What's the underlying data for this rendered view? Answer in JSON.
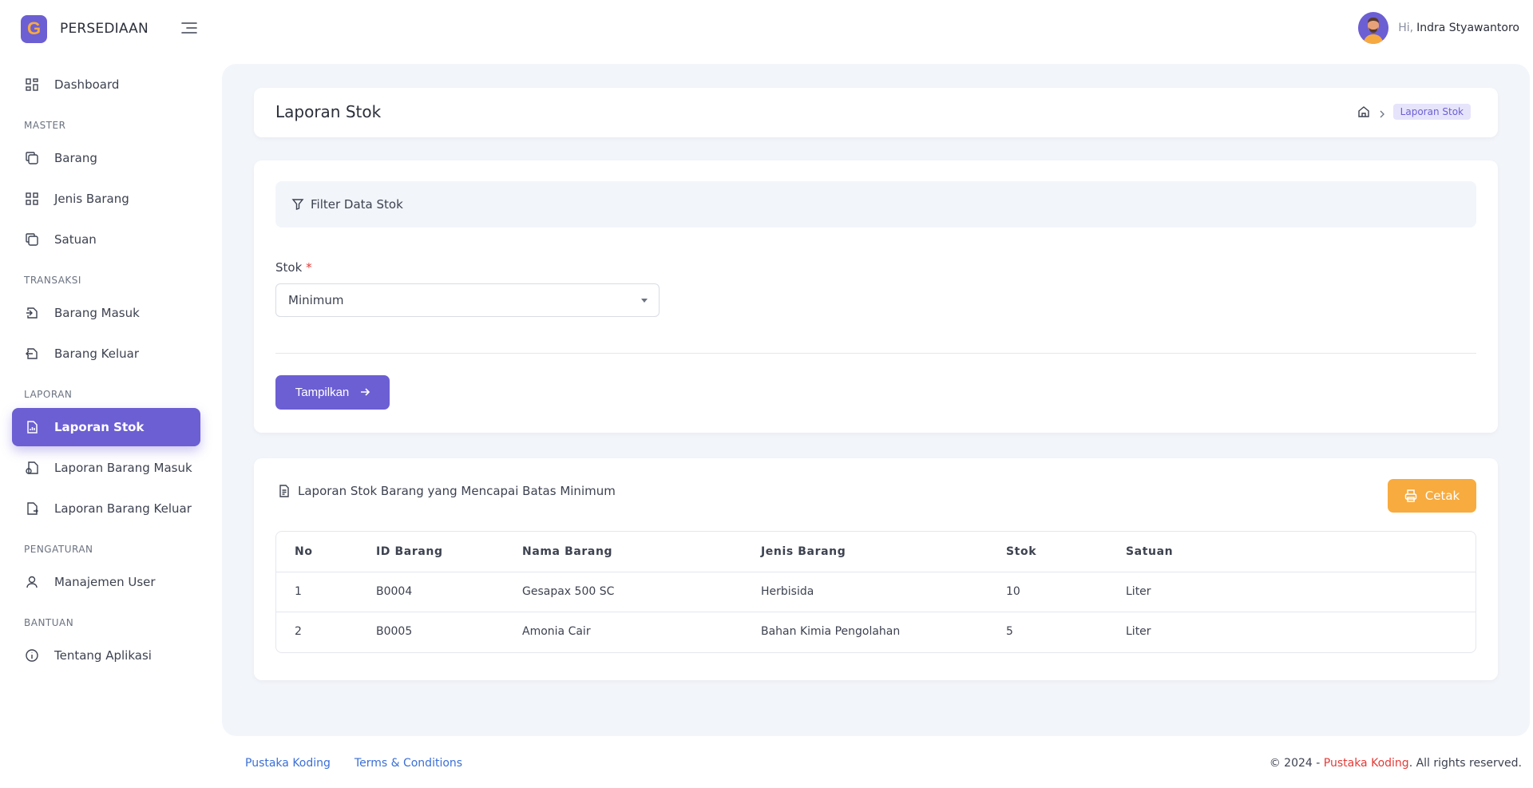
{
  "brand": {
    "logo_letter": "G",
    "name": "PERSEDIAAN"
  },
  "user": {
    "greeting": "Hi,",
    "name": "Indra Styawantoro"
  },
  "sidebar": {
    "dashboard": "Dashboard",
    "sections": {
      "master": "MASTER",
      "transaksi": "TRANSAKSI",
      "laporan": "LAPORAN",
      "pengaturan": "PENGATURAN",
      "bantuan": "BANTUAN"
    },
    "master_items": [
      "Barang",
      "Jenis Barang",
      "Satuan"
    ],
    "transaksi_items": [
      "Barang Masuk",
      "Barang Keluar"
    ],
    "laporan_items": [
      "Laporan Stok",
      "Laporan Barang Masuk",
      "Laporan Barang Keluar"
    ],
    "pengaturan_items": [
      "Manajemen User"
    ],
    "bantuan_items": [
      "Tentang Aplikasi"
    ],
    "active": "Laporan Stok"
  },
  "header": {
    "title": "Laporan Stok",
    "breadcrumb_current": "Laporan Stok"
  },
  "filter": {
    "title": "Filter Data Stok",
    "field_label": "Stok",
    "required_mark": "*",
    "selected": "Minimum",
    "submit_label": "Tampilkan"
  },
  "report": {
    "title": "Laporan Stok Barang yang Mencapai Batas Minimum",
    "print_label": "Cetak",
    "columns": [
      "No",
      "ID Barang",
      "Nama Barang",
      "Jenis Barang",
      "Stok",
      "Satuan"
    ],
    "rows": [
      [
        "1",
        "B0004",
        "Gesapax 500 SC",
        "Herbisida",
        "10",
        "Liter"
      ],
      [
        "2",
        "B0005",
        "Amonia Cair",
        "Bahan Kimia Pengolahan",
        "5",
        "Liter"
      ]
    ]
  },
  "footer": {
    "links": [
      "Pustaka Koding",
      "Terms & Conditions"
    ],
    "copyright_prefix": "© 2024 -",
    "copyright_brand": "Pustaka Koding",
    "copyright_suffix": ". All rights reserved."
  },
  "colors": {
    "primary": "#6c5fd3",
    "accent": "#f8ab3e",
    "link": "#3b6fd6",
    "danger": "#e53935"
  }
}
